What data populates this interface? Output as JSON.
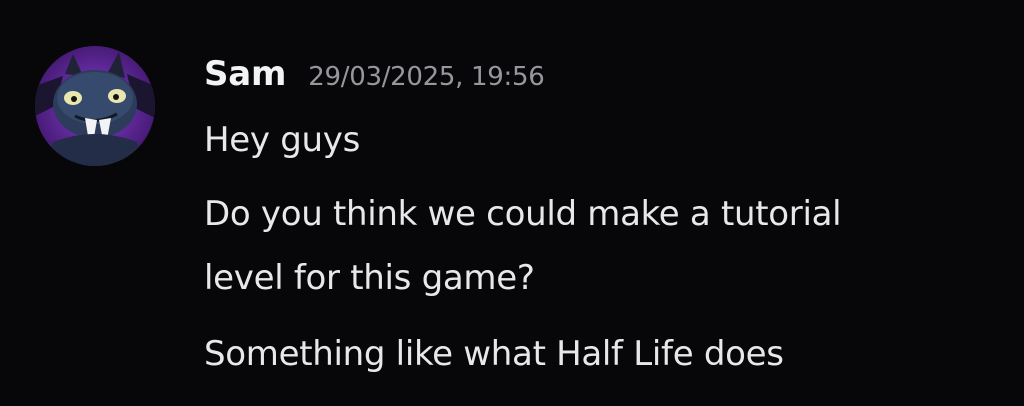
{
  "message": {
    "author": "Sam",
    "timestamp": "29/03/2025, 19:56",
    "avatar_icon": "bat-creature-avatar-icon",
    "lines": [
      "Hey guys",
      "Do you think we could make a tutorial",
      "level for this game?",
      "Something like what Half Life does"
    ]
  },
  "colors": {
    "background": "#070709",
    "username": "#f2f3f5",
    "timestamp": "#96979d",
    "text": "#e8e8ea",
    "avatar_bg": "#6b2fa3"
  }
}
